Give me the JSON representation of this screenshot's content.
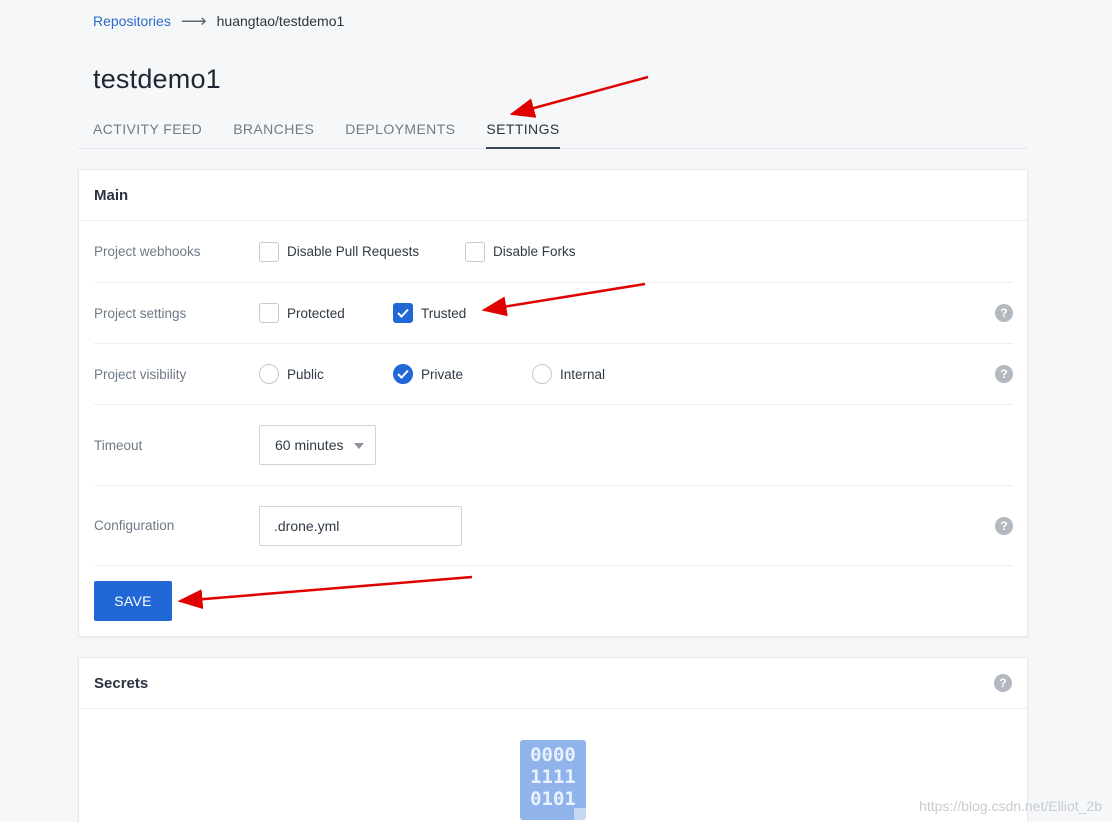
{
  "breadcrumb": {
    "root": "Repositories",
    "separator": "⟶",
    "current": "huangtao/testdemo1"
  },
  "page": {
    "title": "testdemo1"
  },
  "tabs": [
    {
      "label": "ACTIVITY FEED",
      "active": false
    },
    {
      "label": "BRANCHES",
      "active": false
    },
    {
      "label": "DEPLOYMENTS",
      "active": false
    },
    {
      "label": "SETTINGS",
      "active": true
    }
  ],
  "main": {
    "title": "Main",
    "webhooks": {
      "label": "Project webhooks",
      "disable_pull_requests": {
        "label": "Disable Pull Requests",
        "checked": false
      },
      "disable_forks": {
        "label": "Disable Forks",
        "checked": false
      }
    },
    "settings": {
      "label": "Project settings",
      "protected": {
        "label": "Protected",
        "checked": false
      },
      "trusted": {
        "label": "Trusted",
        "checked": true
      }
    },
    "visibility": {
      "label": "Project visibility",
      "options": [
        "Public",
        "Private",
        "Internal"
      ],
      "selected": "Private"
    },
    "timeout": {
      "label": "Timeout",
      "value": "60 minutes"
    },
    "configuration": {
      "label": "Configuration",
      "value": ".drone.yml"
    },
    "save_label": "SAVE",
    "help_glyph": "?"
  },
  "secrets": {
    "title": "Secrets",
    "icon_lines": [
      "0000",
      "1111",
      "0101"
    ]
  },
  "watermark": "https://blog.csdn.net/Elliot_2b",
  "colors": {
    "accent": "#2167d6",
    "link": "#2f69c9",
    "annotation": "#e00000"
  },
  "icons": {
    "check": "check-icon",
    "help": "help-icon",
    "caret": "caret-down-icon",
    "empty_secrets": "binary-file-icon"
  }
}
